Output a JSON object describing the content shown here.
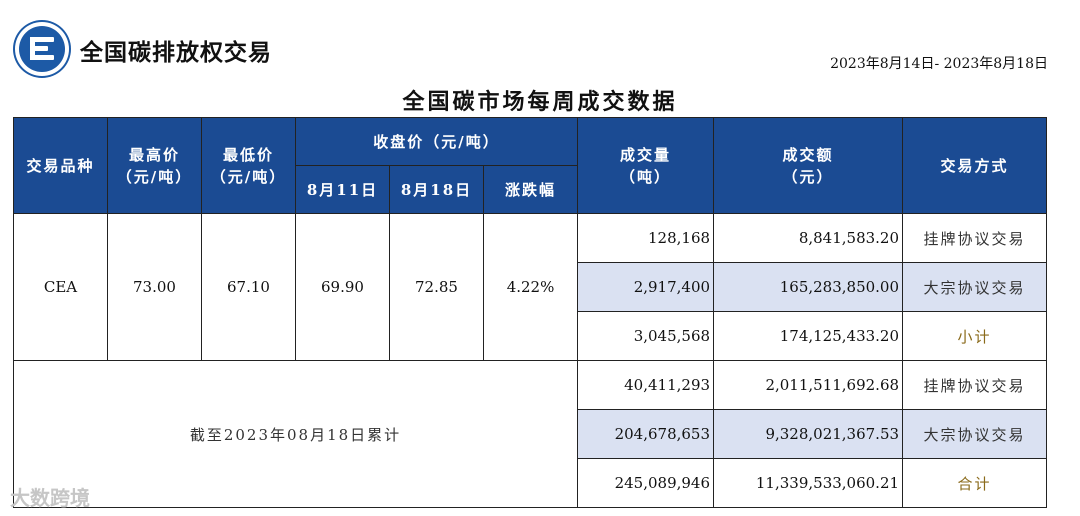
{
  "header": {
    "org_name": "全国碳排放权交易",
    "date_range": "2023年8月14日- 2023年8月18日",
    "logo_icon": "exchange-logo-icon"
  },
  "title": "全国碳市场每周成交数据",
  "columns": {
    "product": "交易品种",
    "high": "最高价",
    "high_unit": "（元/吨）",
    "low": "最低价",
    "low_unit": "（元/吨）",
    "close": "收盘价（元/吨）",
    "close_prev": "8月11日",
    "close_curr": "8月18日",
    "change": "涨跌幅",
    "volume": "成交量",
    "volume_unit": "（吨）",
    "amount": "成交额",
    "amount_unit": "（元）",
    "method": "交易方式"
  },
  "weekly": {
    "product": "CEA",
    "high": "73.00",
    "low": "67.10",
    "close_prev": "69.90",
    "close_curr": "72.85",
    "change": "4.22%",
    "rows": [
      {
        "volume": "128,168",
        "amount": "8,841,583.20",
        "method": "挂牌协议交易"
      },
      {
        "volume": "2,917,400",
        "amount": "165,283,850.00",
        "method": "大宗协议交易"
      },
      {
        "volume": "3,045,568",
        "amount": "174,125,433.20",
        "method": "小计"
      }
    ]
  },
  "cumulative": {
    "label": "截至2023年08月18日累计",
    "rows": [
      {
        "volume": "40,411,293",
        "amount": "2,011,511,692.68",
        "method": "挂牌协议交易"
      },
      {
        "volume": "204,678,653",
        "amount": "9,328,021,367.53",
        "method": "大宗协议交易"
      },
      {
        "volume": "245,089,946",
        "amount": "11,339,533,060.21",
        "method": "合计"
      }
    ]
  },
  "watermark": "大数跨境",
  "colors": {
    "header_bg": "#1b4b93",
    "highlight_row": "#dae1f2"
  }
}
